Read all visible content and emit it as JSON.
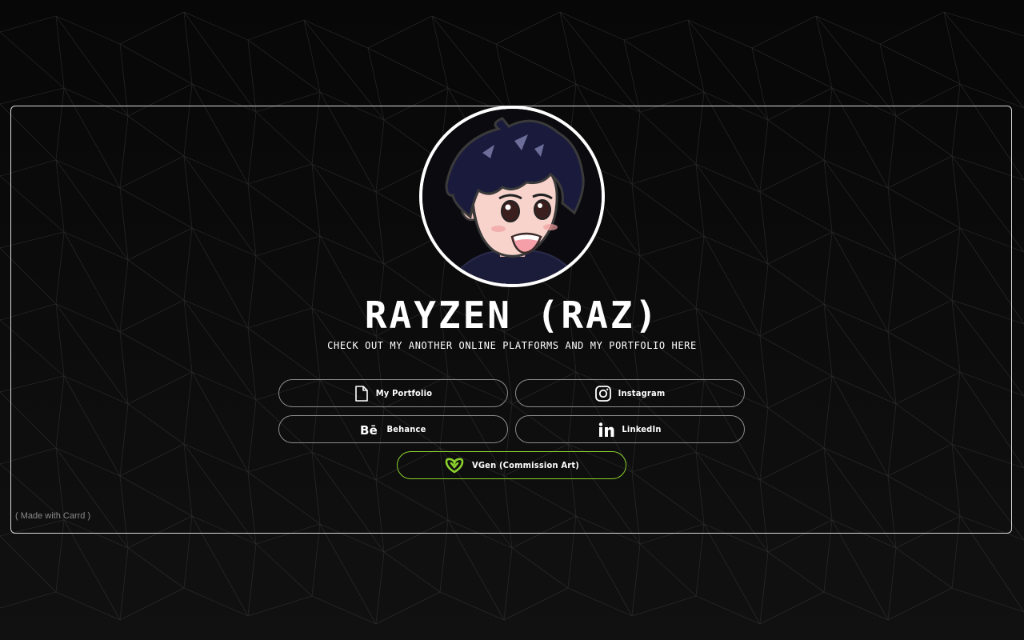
{
  "profile": {
    "name": "RAYZEN (RAZ)",
    "tagline": "CHECK OUT MY ANOTHER ONLINE PLATFORMS AND MY PORTFOLIO HERE"
  },
  "links": {
    "portfolio": {
      "label": "My Portfolio",
      "icon": "document-icon"
    },
    "instagram": {
      "label": "Instagram",
      "icon": "instagram-icon"
    },
    "behance": {
      "label": "Behance",
      "icon": "behance-icon"
    },
    "linkedin": {
      "label": "LinkedIn",
      "icon": "linkedin-icon"
    },
    "vgen": {
      "label": "VGen (Commission Art)",
      "icon": "vgen-icon",
      "accent": "#8bd12c"
    }
  },
  "footer": {
    "label": "( Made with Carrd )"
  },
  "colors": {
    "background": "#0a0a0a",
    "border": "#d8d8d8",
    "button_border": "#8c8c8c",
    "accent": "#8bd12c",
    "muted_text": "#8a8a8a"
  }
}
